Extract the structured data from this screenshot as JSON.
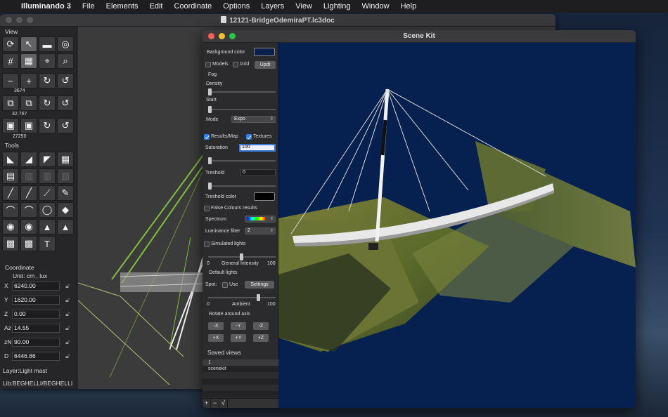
{
  "menubar": {
    "app_name": "Illuminando 3",
    "items": [
      "File",
      "Elements",
      "Edit",
      "Coordinate",
      "Options",
      "Layers",
      "View",
      "Lighting",
      "Window",
      "Help"
    ]
  },
  "main_window": {
    "title": "12121-BridgeOdemiraPT.lc3doc",
    "sections": {
      "view": "View",
      "tools": "Tools",
      "coordinate": "Coordinate"
    },
    "view_tools": [
      [
        "move-sun-icon",
        "select-esc-icon",
        "car-icon",
        "target-icon"
      ],
      [
        "grid-icon",
        "grid-snap-icon",
        "pointer-icon",
        "zoom-area-icon"
      ],
      [
        "zoom-out-icon",
        "zoom-in-icon",
        "rotate-x-icon",
        "rotate-x2-icon"
      ],
      [
        "scale-icon",
        "scale-duplicate-icon",
        "rotate-y-icon",
        "rotate-y2-icon"
      ],
      [
        "camera-icon",
        "camera-add-icon",
        "rotate-z-icon",
        "rotate-z2-icon"
      ]
    ],
    "view_numbers": {
      "zoom": "3674",
      "scale": "32.767",
      "camera": "27250"
    },
    "tool_icons": [
      [
        "luminaire-flood-icon",
        "luminaire-wide-icon",
        "luminaire-array-icon",
        "table-icon"
      ],
      [
        "panel-icon",
        "panel-dim-icon",
        "panel-dim2-icon",
        "panel-dim3-icon"
      ],
      [
        "line-icon",
        "line2-icon",
        "polyline-icon",
        "pen-icon"
      ],
      [
        "arc-icon",
        "arc2-icon",
        "circle-icon",
        "fill-icon"
      ],
      [
        "bulb-icon",
        "bulb2-icon",
        "shapes-icon",
        "shapes2-icon"
      ],
      [
        "projector-icon",
        "projector2-icon",
        "text-tool-icon"
      ]
    ],
    "text_tool_glyph": "T",
    "coordinate": {
      "unit_label": "Unit:  cm ,  lux",
      "fields": [
        {
          "label": "X",
          "value": "6240.00"
        },
        {
          "label": "Y",
          "value": "1620.00"
        },
        {
          "label": "Z",
          "value": "0.00"
        },
        {
          "label": "Az",
          "value": "14.55"
        },
        {
          "label": "zN",
          "value": "90.00"
        },
        {
          "label": "D",
          "value": "6446.86"
        }
      ]
    },
    "layer": "Layer:Light mast",
    "library": "Lib:BEGHELLI/BEGHELLI"
  },
  "scene_kit": {
    "title": "Scene Kit",
    "background_color_label": "Background color",
    "background_color": "#0a1f4a",
    "models_label": "Models",
    "models_checked": false,
    "grid_label": "Grid",
    "grid_checked": false,
    "update_button": "Updt",
    "fog_label": "Fog",
    "density_label": "Density",
    "density": 0,
    "start_label": "Start",
    "start": 0,
    "mode_label": "Mode",
    "mode_value": "Expo",
    "results_map_label": "Results/Map",
    "results_map_checked": true,
    "textures_label": "Textures",
    "textures_checked": true,
    "saturation_label": "Saturation",
    "saturation_value": "100",
    "treshold_label": "Treshold",
    "treshold_value": "0",
    "treshold_color_label": "Treshold color",
    "treshold_color": "#000000",
    "false_colours_label": "False Colours results",
    "false_colours_checked": false,
    "spectrum_label": "Spectrum",
    "luminance_filter_label": "Luminance filter",
    "luminance_filter_value": "2",
    "simulated_lights_label": "Simulated lights",
    "simulated_lights_checked": false,
    "general_intensity_label": "General Intensity",
    "general_intensity_min": "0",
    "general_intensity_max": "100",
    "general_intensity": 50,
    "default_lights_label": "Default lights",
    "spot_label": "Spot:",
    "use_label": "Use",
    "use_checked": false,
    "settings_button": "Settings",
    "ambient_label": "Ambient",
    "ambient_min": "0",
    "ambient_max": "100",
    "ambient": 75,
    "rotate_label": "Rotate around axis",
    "rotate_buttons": [
      "-X",
      "-Y",
      "-Z",
      "+X",
      "+Y",
      "+Z"
    ],
    "saved_views_label": "Saved views",
    "saved_views": [
      "1",
      "scenekit"
    ],
    "bottom_buttons": [
      "+",
      "−",
      "√"
    ]
  },
  "colors": {
    "scene_background": "#06204f",
    "highlight": "#2c7ef5"
  }
}
